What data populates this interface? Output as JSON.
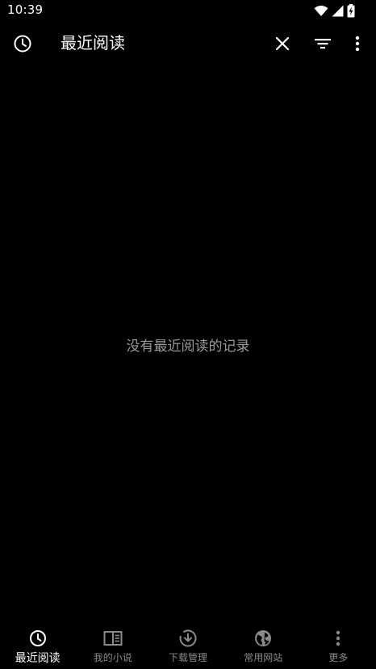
{
  "status_bar": {
    "time": "10:39",
    "icons": [
      "wifi-icon",
      "cell-signal-icon",
      "battery-charging-icon"
    ]
  },
  "app_bar": {
    "title": "最近阅读",
    "nav_icon": "history-clock-icon",
    "actions": [
      "close-icon",
      "filter-icon",
      "more-vert-icon"
    ]
  },
  "empty_state": {
    "message": "没有最近阅读的记录"
  },
  "bottom_nav": {
    "items": [
      {
        "label": "最近阅读",
        "icon": "history-clock-icon",
        "active": true
      },
      {
        "label": "我的小说",
        "icon": "book-icon",
        "active": false
      },
      {
        "label": "下载管理",
        "icon": "download-icon",
        "active": false
      },
      {
        "label": "常用网站",
        "icon": "globe-icon",
        "active": false
      },
      {
        "label": "更多",
        "icon": "more-vert-icon",
        "active": false
      }
    ]
  },
  "colors": {
    "background": "#000000",
    "text_primary": "#ffffff",
    "text_secondary": "#9a9a9a",
    "nav_inactive": "#8a8a8a"
  }
}
